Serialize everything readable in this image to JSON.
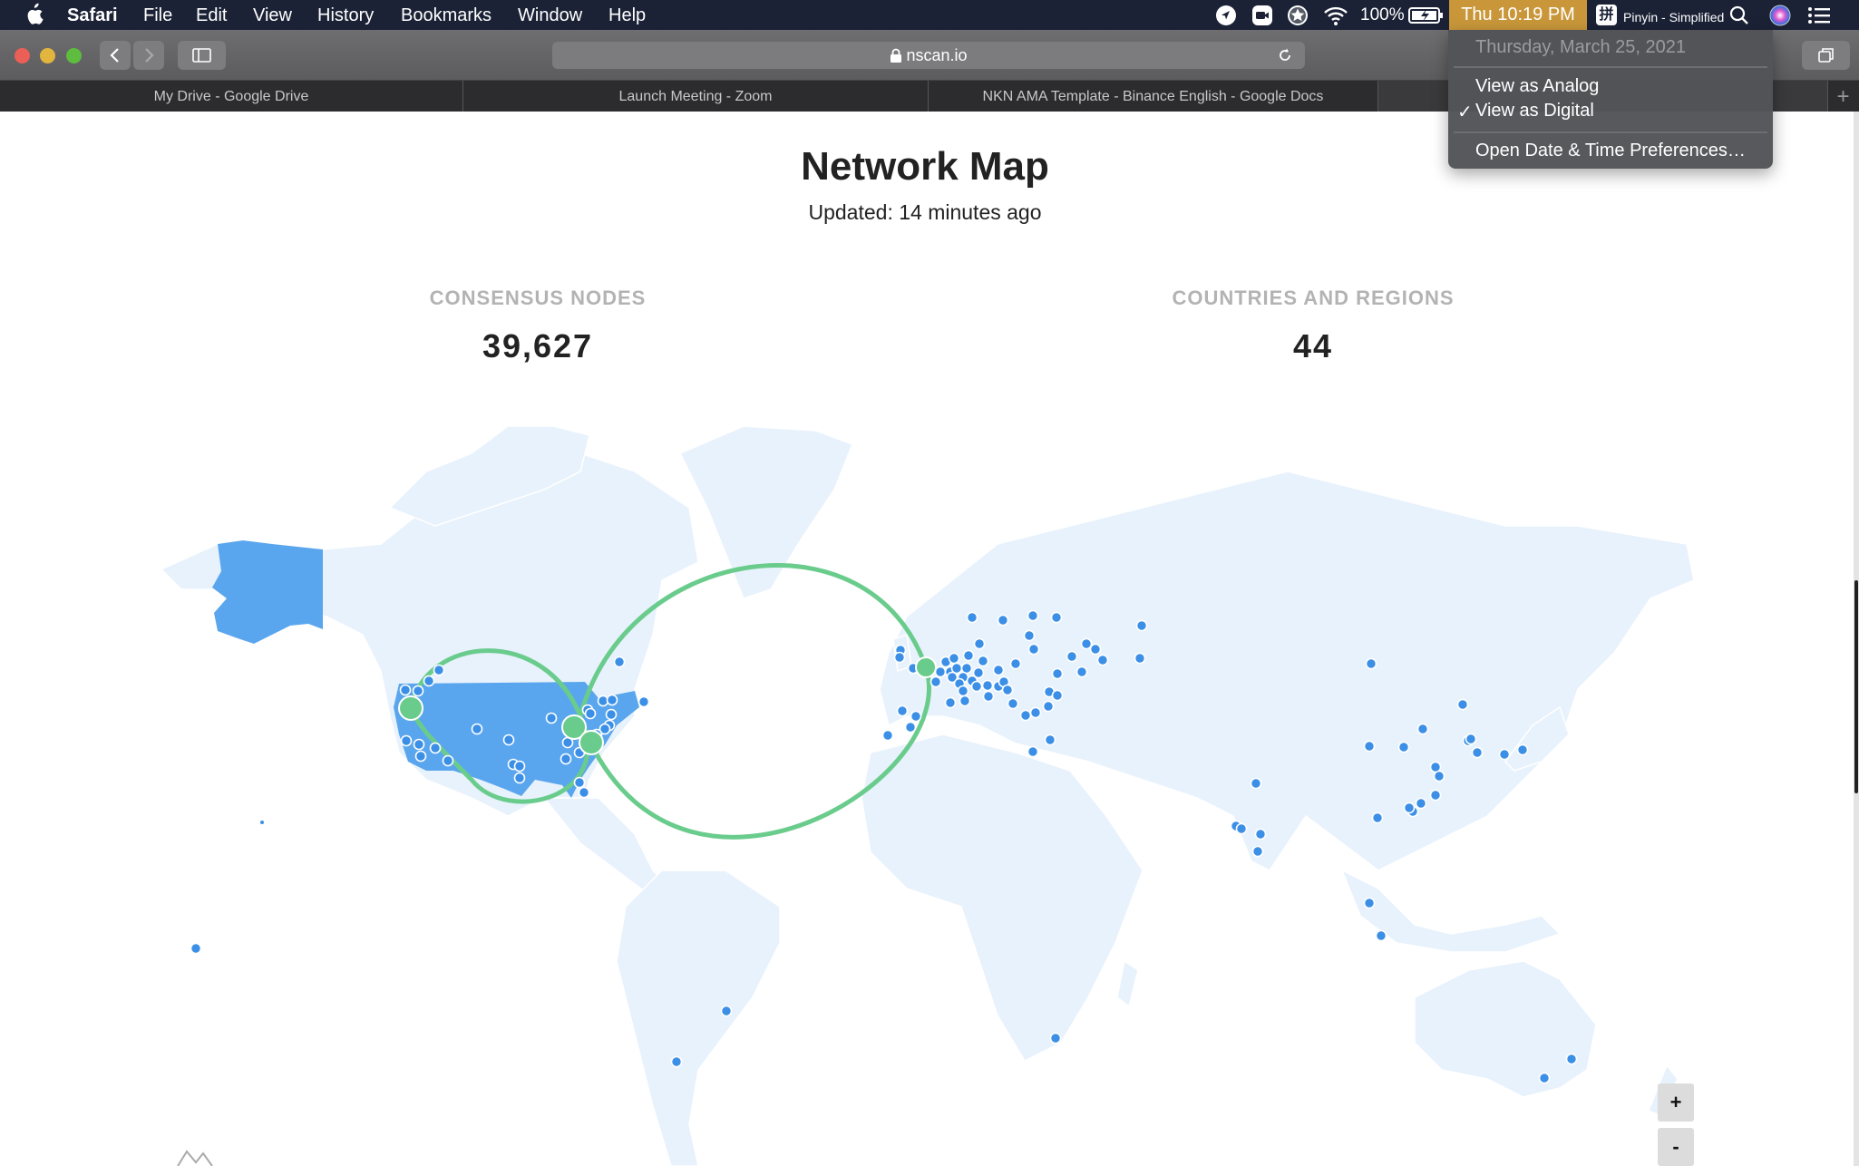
{
  "menubar": {
    "app_name": "Safari",
    "items": [
      "File",
      "Edit",
      "View",
      "History",
      "Bookmarks",
      "Window",
      "Help"
    ],
    "battery_percent": "100%",
    "clock": "Thu 10:19 PM",
    "input_method": "Pinyin - Simplified",
    "input_method_glyph": "拼",
    "status_icons": [
      "location-icon",
      "zoom-video-icon",
      "star-badge-icon",
      "wifi-icon",
      "battery-charging-icon",
      "input-method-icon",
      "spotlight-search-icon",
      "siri-icon",
      "notification-center-icon"
    ]
  },
  "clock_menu": {
    "date": "Thursday, March 25, 2021",
    "items": [
      {
        "label": "View as Analog",
        "checked": false
      },
      {
        "label": "View as Digital",
        "checked": true
      },
      {
        "label": "Open Date & Time Preferences…",
        "checked": false
      }
    ],
    "check_glyph": "✓"
  },
  "browser": {
    "url": "nscan.io",
    "tabs": [
      {
        "label": "My Drive - Google Drive"
      },
      {
        "label": "Launch Meeting - Zoom"
      },
      {
        "label": "NKN AMA Template - Binance English - Google Docs"
      },
      {
        "label": ""
      }
    ],
    "new_tab_glyph": "+"
  },
  "page": {
    "title": "Network Map",
    "updated": "Updated: 14 minutes ago",
    "stats": [
      {
        "label": "CONSENSUS NODES",
        "value": "39,627"
      },
      {
        "label": "COUNTRIES AND REGIONS",
        "value": "44"
      }
    ],
    "zoom_in_label": "+",
    "zoom_out_label": "-"
  },
  "colors": {
    "menubar": "#1b2236",
    "clock_highlight": "#c9973a",
    "land": "#e8f2fc",
    "highlighted_country": "#5aa6ee",
    "node_dot": "#3b8fe6",
    "route_arc": "#6acc8c"
  }
}
